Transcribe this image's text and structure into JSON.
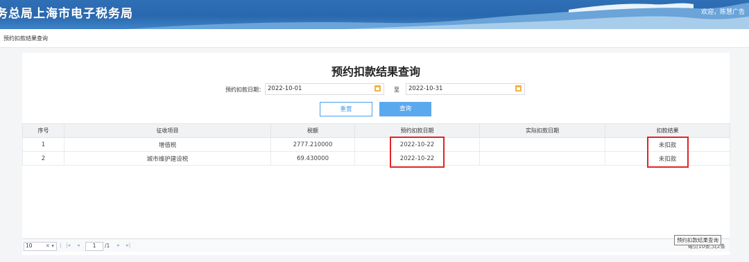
{
  "header": {
    "title": "务总局上海市电子税务局",
    "welcome": "欢迎，陈慧广告"
  },
  "breadcrumb": "预约扣款结果查询",
  "main": {
    "title": "预约扣款结果查询",
    "date_label": "预约扣款日期：",
    "date_from": "2022-10-01",
    "to_label": "至",
    "date_to": "2022-10-31",
    "reset_label": "重置",
    "query_label": "查询"
  },
  "table": {
    "headers": [
      "序号",
      "征收项目",
      "税额",
      "预约扣款日期",
      "实际扣款日期",
      "扣款结果"
    ],
    "rows": [
      [
        "1",
        "增值税",
        "2777.210000",
        "2022-10-22",
        "",
        "未扣款"
      ],
      [
        "2",
        "城市维护建设税",
        "69.430000",
        "2022-10-22",
        "",
        "未扣款"
      ]
    ]
  },
  "pager": {
    "page_size": "10",
    "page": "1",
    "total_pages": "/1",
    "records": "每页10条,共2条"
  },
  "tooltip": "预约扣款结果查询",
  "colors": {
    "header_blue": "#2a68ad",
    "button_blue": "#5aa9ee",
    "highlight_red": "#e02424",
    "calendar_icon": "#f3b23f"
  }
}
